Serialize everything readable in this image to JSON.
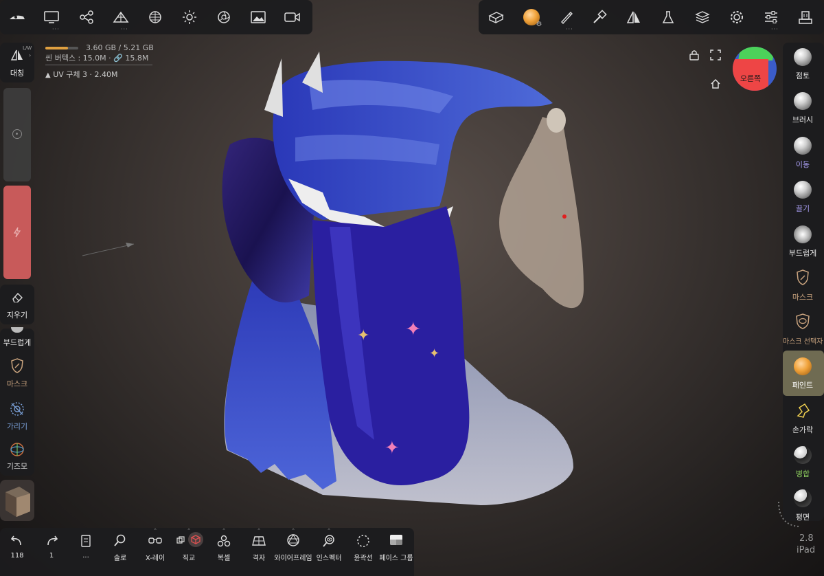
{
  "stats": {
    "memory": "3.60 GB / 5.21 GB",
    "vertices": "씬 버텍스 : 15.0M · ",
    "link_count": "15.8M",
    "object": "UV 구체 3 · 2.40M"
  },
  "top_left_tools": [
    "scene-icon",
    "display-icon",
    "share-icon",
    "mesh-icon",
    "grid-icon",
    "light-icon",
    "aperture-icon",
    "image-icon",
    "video-icon"
  ],
  "top_right_tools": [
    "gizmo-box-icon",
    "material-icon",
    "brush-icon",
    "tube-icon",
    "symmetry-icon",
    "flask-icon",
    "layers-icon",
    "settings-icon",
    "sliders-icon",
    "stamp-icon"
  ],
  "left": {
    "symmetry": "대칭",
    "symmetry_badge": "L/W",
    "eraser": "지우기",
    "smooth": "부드럽게",
    "mask": "마스크",
    "hide": "가리기",
    "gizmo": "기즈모"
  },
  "right": [
    {
      "label": "점토",
      "color": "#e6e6e6"
    },
    {
      "label": "브러시",
      "color": "#e6e6e6"
    },
    {
      "label": "이동",
      "color": "#a79cf0"
    },
    {
      "label": "끌기",
      "color": "#a79cf0"
    },
    {
      "label": "부드럽게",
      "color": "#e6e6e6"
    },
    {
      "label": "마스크",
      "color": "#c9a37e"
    },
    {
      "label": "마스크 선택자",
      "color": "#c9a37e"
    },
    {
      "label": "페인트",
      "color": "#ffffff"
    },
    {
      "label": "손가락",
      "color": "#e6e6e6"
    },
    {
      "label": "병합",
      "color": "#8fd05f"
    },
    {
      "label": "평면",
      "color": "#e6e6e6"
    }
  ],
  "active_right": "페인트",
  "bottom": {
    "undo_count": "118",
    "redo_count": "1",
    "menu": "...",
    "solo": "솔로",
    "xray": "X-레이",
    "ortho": "직교",
    "clone": "복셀",
    "grid": "격자",
    "wireframe": "와이어프레임",
    "inspector": "인스펙터",
    "outline": "윤곽선",
    "facegroup": "페이스 그룹"
  },
  "cube_label": "오른쪽",
  "version": "2.8",
  "device": "iPad",
  "colors": {
    "accent": "#f0a23a",
    "paint_active_bg": "#6f6b52",
    "red_slider": "#c85a5a"
  }
}
